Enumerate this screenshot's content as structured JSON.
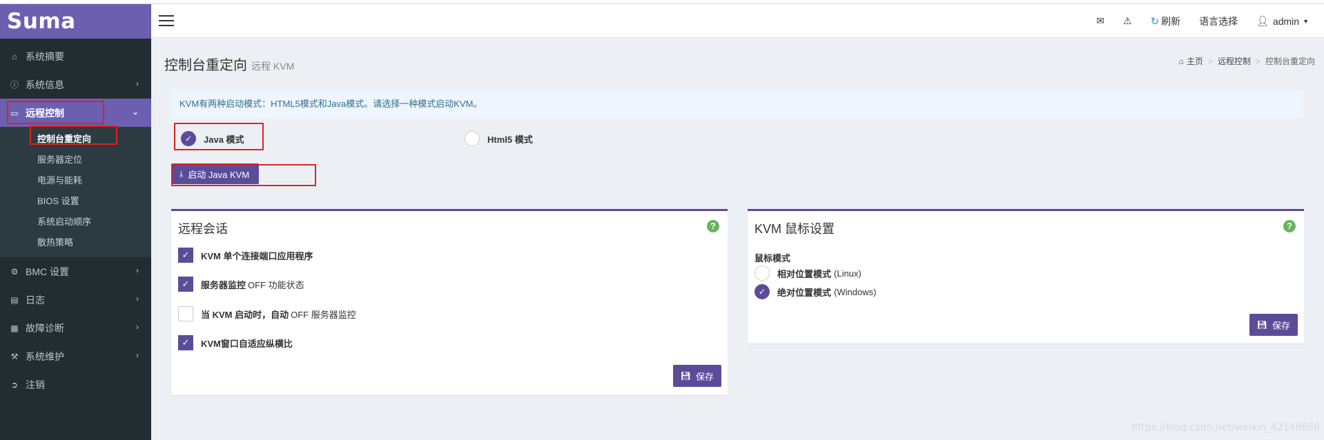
{
  "app": {
    "logo": "Suma"
  },
  "sidebar": {
    "items": [
      {
        "label": "系统摘要",
        "icon": "home-icon"
      },
      {
        "label": "系统信息",
        "icon": "info-icon"
      },
      {
        "label": "远程控制",
        "icon": "monitor-icon"
      },
      {
        "label": "BMC 设置",
        "icon": "gear-icon"
      },
      {
        "label": "日志",
        "icon": "database-icon"
      },
      {
        "label": "故障诊断",
        "icon": "bar-chart-icon"
      },
      {
        "label": "系统维护",
        "icon": "wrench-icon"
      },
      {
        "label": "注销",
        "icon": "sign-out-icon"
      }
    ],
    "submenu": [
      "控制台重定向",
      "服务器定位",
      "电源与能耗",
      "BIOS 设置",
      "系统启动顺序",
      "散热策略"
    ]
  },
  "header": {
    "refresh_label": "刷新",
    "language_label": "语言选择",
    "user_label": "admin"
  },
  "page": {
    "title": "控制台重定向",
    "subtitle": "远程 KVM",
    "breadcrumb": [
      "主页",
      "远程控制",
      "控制台重定向"
    ]
  },
  "kvm": {
    "alert": "KVM有两种启动模式：HTML5模式和Java模式。请选择一种模式启动KVM。",
    "java_mode_label": "Java 模式",
    "html5_mode_label": "Html5 模式",
    "selected_mode": "java",
    "launch_button": "启动 Java KVM"
  },
  "remote_session": {
    "title": "远程会话",
    "options": [
      {
        "bold": "KVM 单个连接端口应用程序",
        "rest": "",
        "checked": true
      },
      {
        "bold": "服务器监控",
        "rest": "OFF 功能状态",
        "checked": true
      },
      {
        "bold": "当 KVM 启动时，自动",
        "rest": "OFF 服务器监控",
        "checked": false
      },
      {
        "bold": "KVM窗口自适应纵横比",
        "rest": "",
        "checked": true
      }
    ],
    "save_label": "保存"
  },
  "mouse_settings": {
    "title": "KVM 鼠标设置",
    "mode_label": "鼠标模式",
    "options": [
      {
        "bold": "相对位置模式",
        "rest": "(Linux)",
        "selected": false
      },
      {
        "bold": "绝对位置模式",
        "rest": "(Windows)",
        "selected": true
      }
    ],
    "save_label": "保存"
  },
  "watermark": "https://blog.csdn.net/weixin_42148668",
  "colors": {
    "brand": "#6c5fb0",
    "primary": "#5b4c9a",
    "sidebar": "#222d32",
    "help": "#68b45a",
    "highlight": "#e02020"
  }
}
